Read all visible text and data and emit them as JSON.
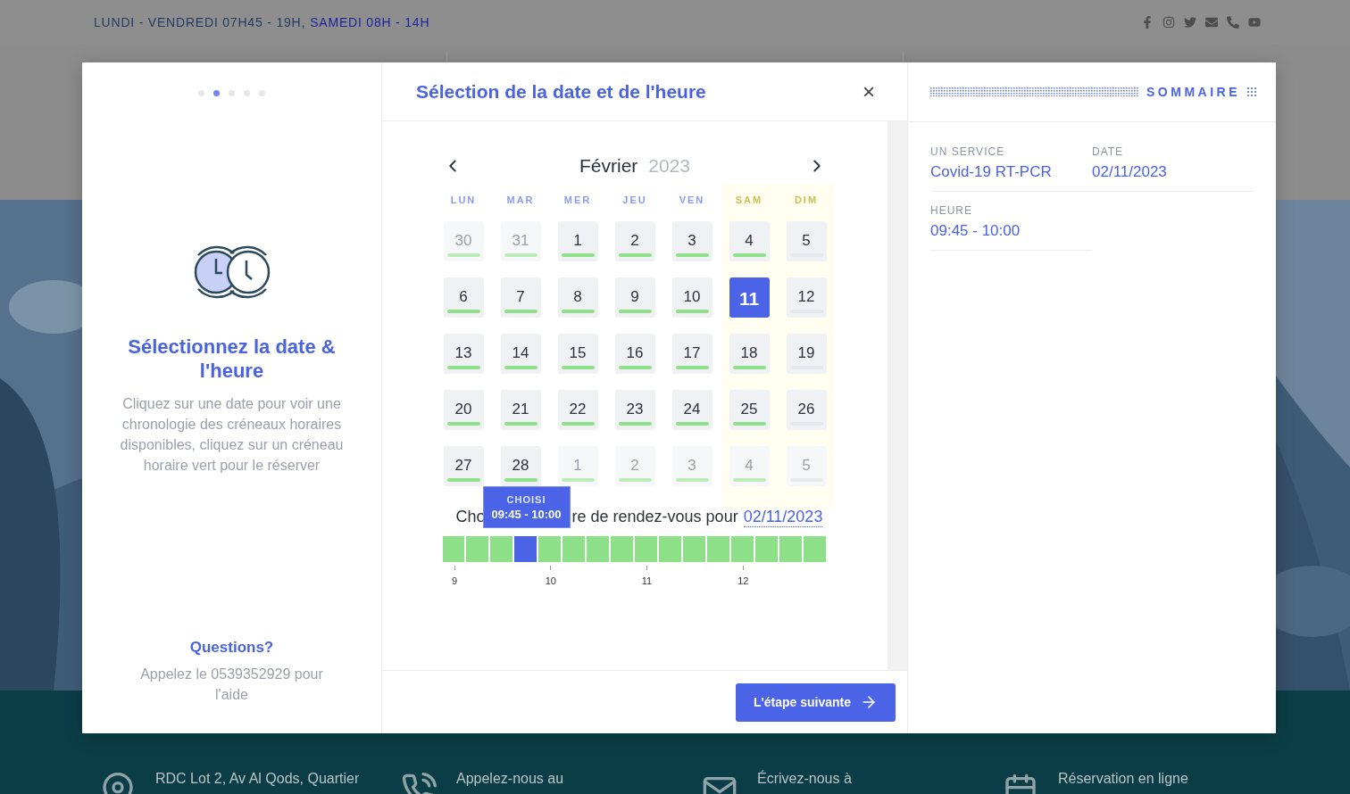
{
  "top_bar": {
    "hours_weekdays": "LUNDI - VENDREDI 07H45 - 19H,",
    "hours_saturday": "SAMEDI 08H - 14H"
  },
  "footer": {
    "items": [
      {
        "kind": "location",
        "text": "RDC Lot 2, Av Al Qods, Quartier"
      },
      {
        "kind": "phone",
        "text": "Appelez-nous au"
      },
      {
        "kind": "mail",
        "text": "Écrivez-nous à"
      },
      {
        "kind": "calendar",
        "text": "Réservation en ligne"
      }
    ]
  },
  "modal": {
    "steps": [
      {
        "selected": false
      },
      {
        "selected": true
      },
      {
        "selected": false
      },
      {
        "selected": false
      },
      {
        "selected": false
      }
    ],
    "intro": {
      "title": "Sélectionnez la date & l'heure",
      "description": "Cliquez sur une date pour voir une chronologie des créneaux horaires disponibles, cliquez sur un créneau horaire vert pour le réserver"
    },
    "help": {
      "title": "Questions?",
      "text": "Appelez le 0539352929 pour l'aide"
    },
    "title": "Sélection de la date et de l'heure",
    "close": "×",
    "calendar": {
      "month": "Février",
      "year": "2023",
      "weekdays": [
        {
          "label": "LUN",
          "weekend": false
        },
        {
          "label": "MAR",
          "weekend": false
        },
        {
          "label": "MER",
          "weekend": false
        },
        {
          "label": "JEU",
          "weekend": false
        },
        {
          "label": "VEN",
          "weekend": false
        },
        {
          "label": "SAM",
          "weekend": true
        },
        {
          "label": "DIM",
          "weekend": true
        }
      ],
      "days": [
        {
          "day": "30",
          "other_month": true,
          "available": true,
          "selected": false
        },
        {
          "day": "31",
          "other_month": true,
          "available": true,
          "selected": false
        },
        {
          "day": "1",
          "other_month": false,
          "available": true,
          "selected": false
        },
        {
          "day": "2",
          "other_month": false,
          "available": true,
          "selected": false
        },
        {
          "day": "3",
          "other_month": false,
          "available": true,
          "selected": false
        },
        {
          "day": "4",
          "other_month": false,
          "available": true,
          "selected": false
        },
        {
          "day": "5",
          "other_month": false,
          "available": false,
          "selected": false
        },
        {
          "day": "6",
          "other_month": false,
          "available": true,
          "selected": false
        },
        {
          "day": "7",
          "other_month": false,
          "available": true,
          "selected": false
        },
        {
          "day": "8",
          "other_month": false,
          "available": true,
          "selected": false
        },
        {
          "day": "9",
          "other_month": false,
          "available": true,
          "selected": false
        },
        {
          "day": "10",
          "other_month": false,
          "available": true,
          "selected": false
        },
        {
          "day": "11",
          "other_month": false,
          "selected": true
        },
        {
          "day": "12",
          "other_month": false,
          "available": false,
          "selected": false
        },
        {
          "day": "13",
          "other_month": false,
          "available": true,
          "selected": false
        },
        {
          "day": "14",
          "other_month": false,
          "available": true,
          "selected": false
        },
        {
          "day": "15",
          "other_month": false,
          "available": true,
          "selected": false
        },
        {
          "day": "16",
          "other_month": false,
          "available": true,
          "selected": false
        },
        {
          "day": "17",
          "other_month": false,
          "available": true,
          "selected": false
        },
        {
          "day": "18",
          "other_month": false,
          "available": true,
          "selected": false
        },
        {
          "day": "19",
          "other_month": false,
          "available": false,
          "selected": false
        },
        {
          "day": "20",
          "other_month": false,
          "available": true,
          "selected": false
        },
        {
          "day": "21",
          "other_month": false,
          "available": true,
          "selected": false
        },
        {
          "day": "22",
          "other_month": false,
          "available": true,
          "selected": false
        },
        {
          "day": "23",
          "other_month": false,
          "available": true,
          "selected": false
        },
        {
          "day": "24",
          "other_month": false,
          "available": true,
          "selected": false
        },
        {
          "day": "25",
          "other_month": false,
          "available": true,
          "selected": false
        },
        {
          "day": "26",
          "other_month": false,
          "available": false,
          "selected": false
        },
        {
          "day": "27",
          "other_month": false,
          "available": true,
          "selected": false
        },
        {
          "day": "28",
          "other_month": false,
          "available": true,
          "selected": false
        },
        {
          "day": "1",
          "other_month": true,
          "available": true,
          "selected": false
        },
        {
          "day": "2",
          "other_month": true,
          "available": true,
          "selected": false
        },
        {
          "day": "3",
          "other_month": true,
          "available": true,
          "selected": false
        },
        {
          "day": "4",
          "other_month": true,
          "available": true,
          "selected": false
        },
        {
          "day": "5",
          "other_month": true,
          "available": false,
          "selected": false
        }
      ]
    },
    "timeline": {
      "prompt_start": "Cho",
      "prompt_end": "re de rendez-vous pour",
      "date": "02/11/2023",
      "tooltip": {
        "label": "CHOISI",
        "time": "09:45 - 10:00"
      },
      "slots": [
        {
          "selected": false
        },
        {
          "selected": false
        },
        {
          "selected": false
        },
        {
          "selected": true
        },
        {
          "selected": false
        },
        {
          "selected": false
        },
        {
          "selected": false
        },
        {
          "selected": false
        },
        {
          "selected": false
        },
        {
          "selected": false
        },
        {
          "selected": false
        },
        {
          "selected": false
        },
        {
          "selected": false
        },
        {
          "selected": false
        },
        {
          "selected": false
        },
        {
          "selected": false
        }
      ],
      "ticks": [
        "9",
        "10",
        "11",
        "12"
      ]
    },
    "next_button": "L'étape suivante",
    "summary": {
      "title": "SOMMAIRE",
      "rows": [
        [
          {
            "label": "UN SERVICE",
            "value": "Covid-19 RT-PCR"
          },
          {
            "label": "DATE",
            "value": "02/11/2023"
          }
        ],
        [
          {
            "label": "HEURE",
            "value": "09:45 - 10:00"
          }
        ]
      ]
    }
  }
}
